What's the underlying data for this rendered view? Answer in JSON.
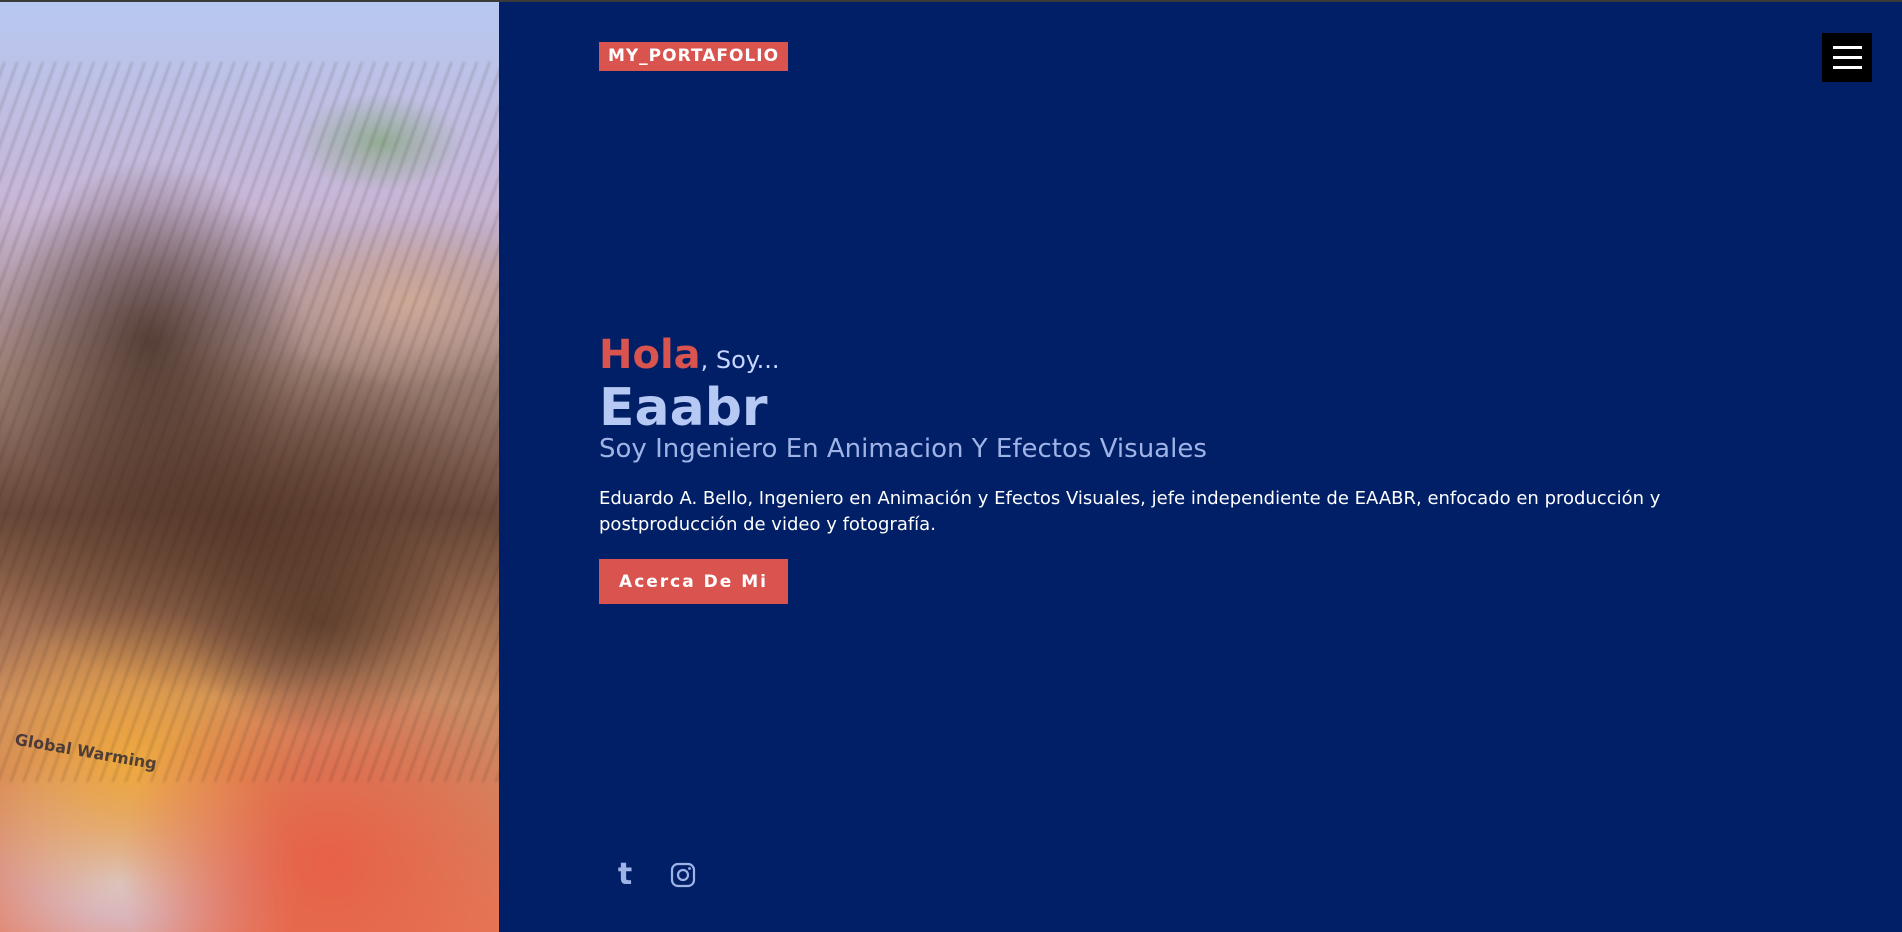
{
  "header": {
    "logo_text": "MY_PORTAFOLIO",
    "menu_icon": "hamburger-icon"
  },
  "hero": {
    "greeting_accent": "Hola",
    "greeting_rest": ", Soy...",
    "name": "Eaabr",
    "role": "Soy Ingeniero En Animacion Y Efectos Visuales",
    "description": "Eduardo A. Bello, Ingeniero en Animación y Efectos Visuales, jefe independiente de EAABR, enfocado en producción y postproducción de video y fotografía.",
    "cta_label": "Acerca De Mi"
  },
  "photo": {
    "shirt_text": "Global Warming"
  },
  "social": [
    {
      "icon": "tumblr-icon",
      "glyph": "t"
    },
    {
      "icon": "instagram-icon"
    }
  ],
  "colors": {
    "background": "#001f66",
    "accent": "#d9534f",
    "muted_text": "#9fb3e6",
    "name_text": "#b6c8f4"
  }
}
